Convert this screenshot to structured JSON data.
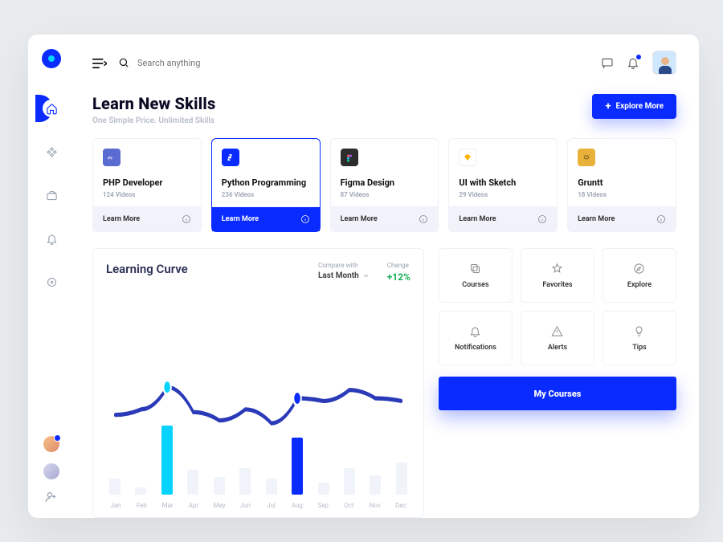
{
  "search": {
    "placeholder": "Search anything"
  },
  "hero": {
    "title": "Learn New Skills",
    "subtitle": "One Simple Price. Unlimited Skills",
    "cta": "Explore More"
  },
  "courses": [
    {
      "name": "PHP Developer",
      "videos": "124 Videos",
      "learn": "Learn More",
      "badge_bg": "#5a6bd1"
    },
    {
      "name": "Python Programming",
      "videos": "236 Videos",
      "learn": "Learn More",
      "badge_bg": "#0a2bff"
    },
    {
      "name": "Figma Design",
      "videos": "87 Videos",
      "learn": "Learn More",
      "badge_bg": "#2c2c2c"
    },
    {
      "name": "UI with Sketch",
      "videos": "29 Videos",
      "learn": "Learn More",
      "badge_bg": "#ffffff"
    },
    {
      "name": "Gruntt",
      "videos": "18 Videos",
      "learn": "Learn More",
      "badge_bg": "#e8b23a"
    }
  ],
  "chart": {
    "title": "Learning Curve",
    "compare_label": "Compare with",
    "compare_value": "Last Month",
    "change_label": "Change",
    "change_value": "+12%"
  },
  "chart_data": {
    "type": "bar",
    "title": "Learning Curve",
    "categories": [
      "Jan",
      "Feb",
      "Mar",
      "Apr",
      "May",
      "Jun",
      "Jul",
      "Aug",
      "Sep",
      "Oct",
      "Nov",
      "Dec"
    ],
    "values": [
      18,
      8,
      78,
      28,
      20,
      30,
      18,
      65,
      14,
      30,
      22,
      36
    ],
    "highlight": {
      "Mar": "cyan",
      "Aug": "blue"
    },
    "overlay_line": [
      48,
      52,
      68,
      50,
      44,
      52,
      42,
      60,
      58,
      66,
      60,
      58
    ],
    "ylim": [
      0,
      100
    ]
  },
  "tiles": [
    {
      "label": "Courses"
    },
    {
      "label": "Favorites"
    },
    {
      "label": "Explore"
    },
    {
      "label": "Notifications"
    },
    {
      "label": "Alerts"
    },
    {
      "label": "Tips"
    }
  ],
  "my_courses": "My Courses"
}
